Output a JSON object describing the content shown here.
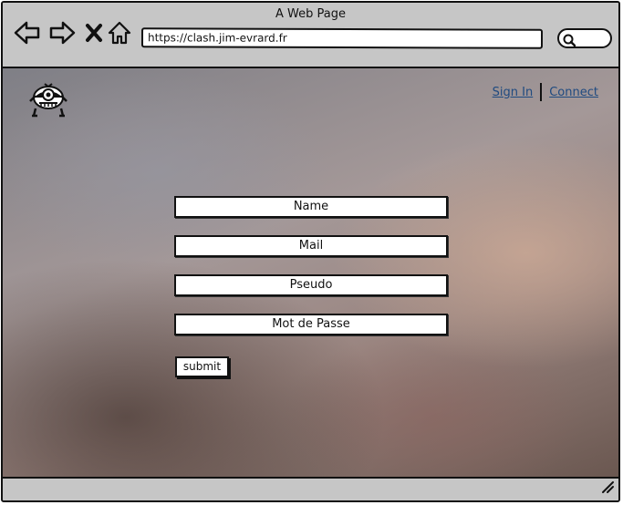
{
  "window": {
    "title": "A Web Page"
  },
  "toolbar": {
    "url": "https://clash.jim-evrard.fr",
    "icons": [
      "back-icon",
      "forward-icon",
      "close-icon",
      "home-icon",
      "search-icon"
    ]
  },
  "header": {
    "logo_icon": "robot-mascot-icon",
    "links": {
      "sign_in": "Sign In",
      "connect": "Connect"
    },
    "link_color": "#1f4a80"
  },
  "form": {
    "name_placeholder": "Name",
    "mail_placeholder": "Mail",
    "pseudo_placeholder": "Pseudo",
    "password_placeholder": "Mot de Passe",
    "submit_label": "submit"
  }
}
